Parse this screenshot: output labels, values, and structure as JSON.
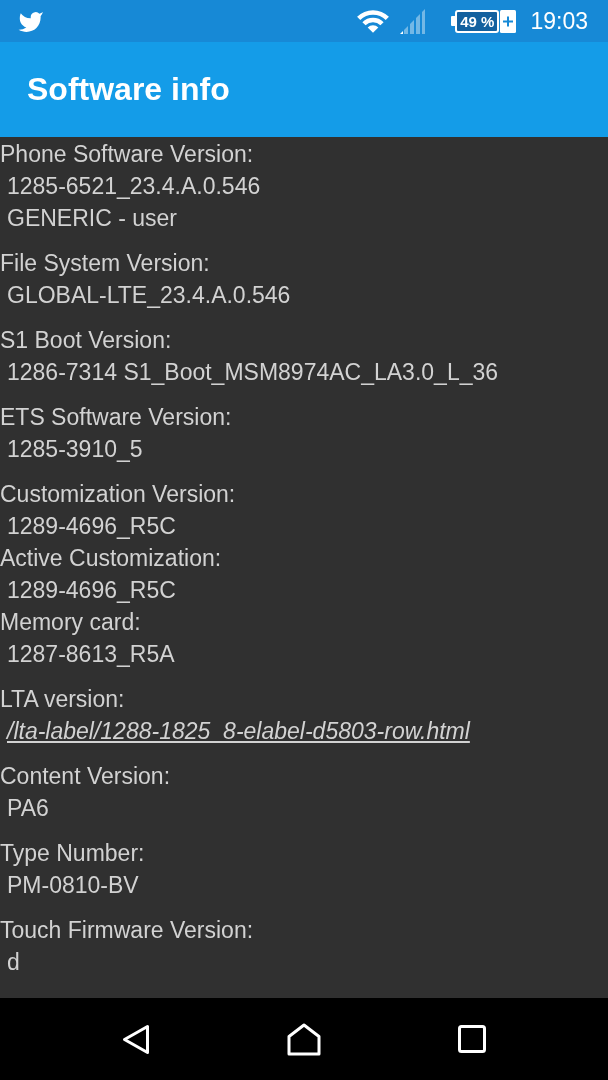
{
  "status_bar": {
    "battery": "49 %",
    "charging": true,
    "time": "19:03"
  },
  "app_bar": {
    "title": "Software info"
  },
  "groups": [
    {
      "entries": [
        {
          "label": "Phone Software Version:",
          "values": [
            {
              "kind": "text",
              "text": "1285-6521_23.4.A.0.546"
            },
            {
              "kind": "text",
              "text": "GENERIC - user"
            }
          ]
        }
      ]
    },
    {
      "entries": [
        {
          "label": "File System Version:",
          "values": [
            {
              "kind": "text",
              "text": "GLOBAL-LTE_23.4.A.0.546"
            }
          ]
        }
      ]
    },
    {
      "entries": [
        {
          "label": "S1 Boot Version:",
          "values": [
            {
              "kind": "text",
              "text": "1286-7314 S1_Boot_MSM8974AC_LA3.0_L_36"
            }
          ]
        }
      ]
    },
    {
      "entries": [
        {
          "label": "ETS Software Version:",
          "values": [
            {
              "kind": "text",
              "text": "1285-3910_5"
            }
          ]
        }
      ]
    },
    {
      "entries": [
        {
          "label": "Customization Version:",
          "values": [
            {
              "kind": "text",
              "text": "1289-4696_R5C"
            }
          ]
        },
        {
          "label": "Active Customization:",
          "values": [
            {
              "kind": "text",
              "text": "1289-4696_R5C"
            }
          ]
        },
        {
          "label": "Memory card:",
          "values": [
            {
              "kind": "text",
              "text": "1287-8613_R5A"
            }
          ]
        }
      ]
    },
    {
      "entries": [
        {
          "label": "LTA version:",
          "values": [
            {
              "kind": "link",
              "text": "/lta-label/1288-1825_8-elabel-d5803-row.html"
            }
          ]
        }
      ]
    },
    {
      "entries": [
        {
          "label": "Content Version:",
          "values": [
            {
              "kind": "text",
              "text": "PA6"
            }
          ]
        }
      ]
    },
    {
      "entries": [
        {
          "label": "Type Number:",
          "values": [
            {
              "kind": "text",
              "text": "PM-0810-BV"
            }
          ]
        }
      ]
    },
    {
      "entries": [
        {
          "label": "Touch Firmware Version:",
          "values": [
            {
              "kind": "text",
              "text": "d"
            }
          ]
        }
      ]
    }
  ]
}
